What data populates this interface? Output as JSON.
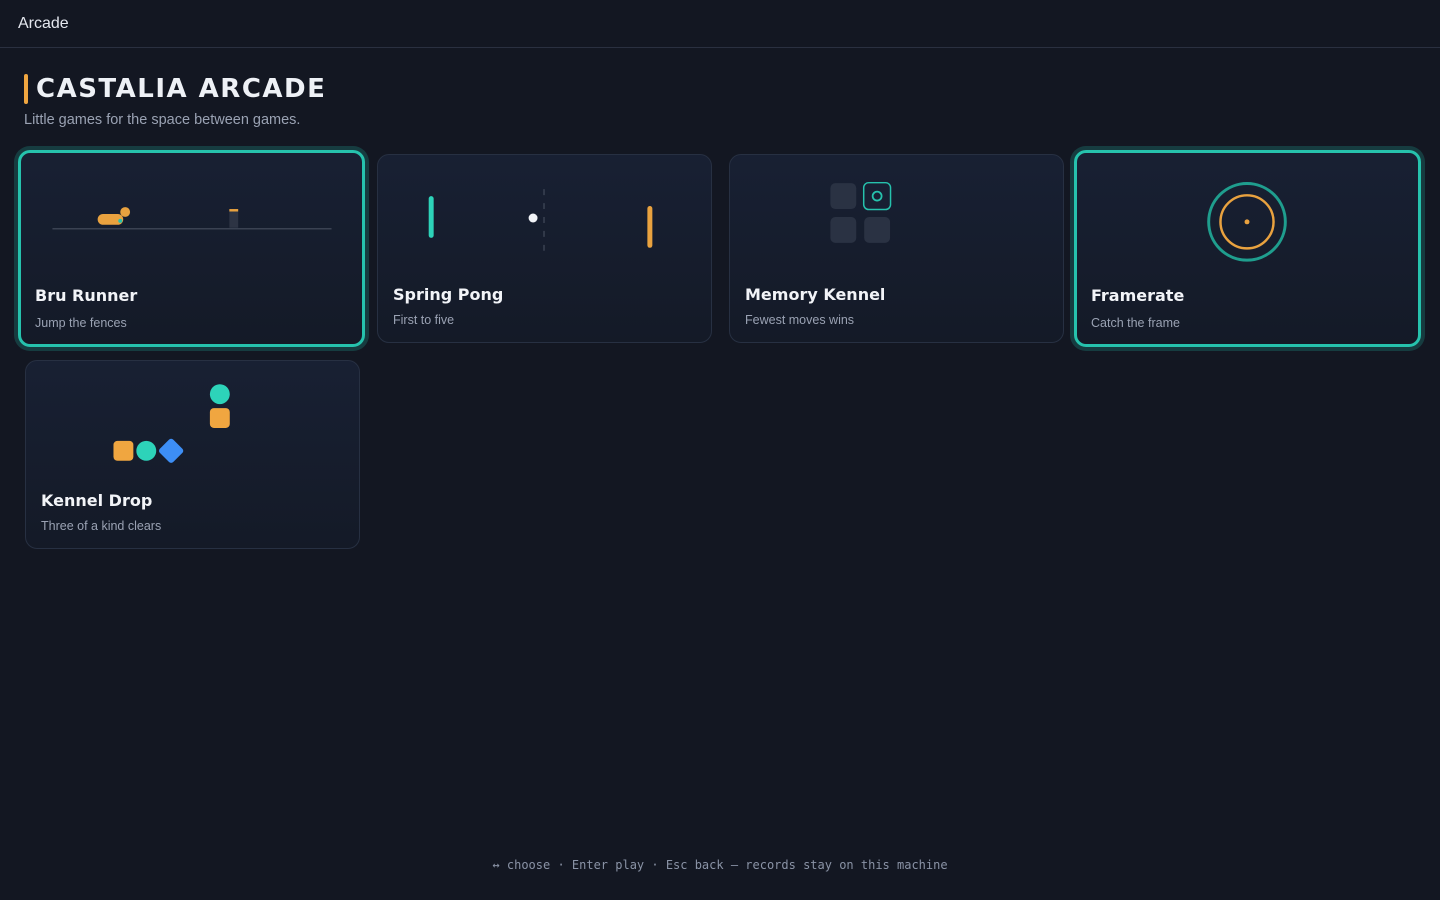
{
  "topbar": {
    "title": "Arcade"
  },
  "header": {
    "title": "CASTALIA ARCADE",
    "subtitle": "Little games for the space between games."
  },
  "games": [
    {
      "name": "Bru Runner",
      "description": "Jump the fences",
      "selected": true
    },
    {
      "name": "Spring Pong",
      "description": "First to five",
      "selected": false
    },
    {
      "name": "Memory Kennel",
      "description": "Fewest moves wins",
      "selected": false
    },
    {
      "name": "Framerate",
      "description": "Catch the frame",
      "selected": true
    },
    {
      "name": "Kennel Drop",
      "description": "Three of a kind clears",
      "selected": false
    }
  ],
  "footer": {
    "hint": "↔ choose · Enter play · Esc back — records stay on this machine"
  },
  "colors": {
    "background": "#131722",
    "accent_orange": "#f0a640",
    "accent_teal": "#26c2ad",
    "accent_blue": "#3d8ef5"
  }
}
